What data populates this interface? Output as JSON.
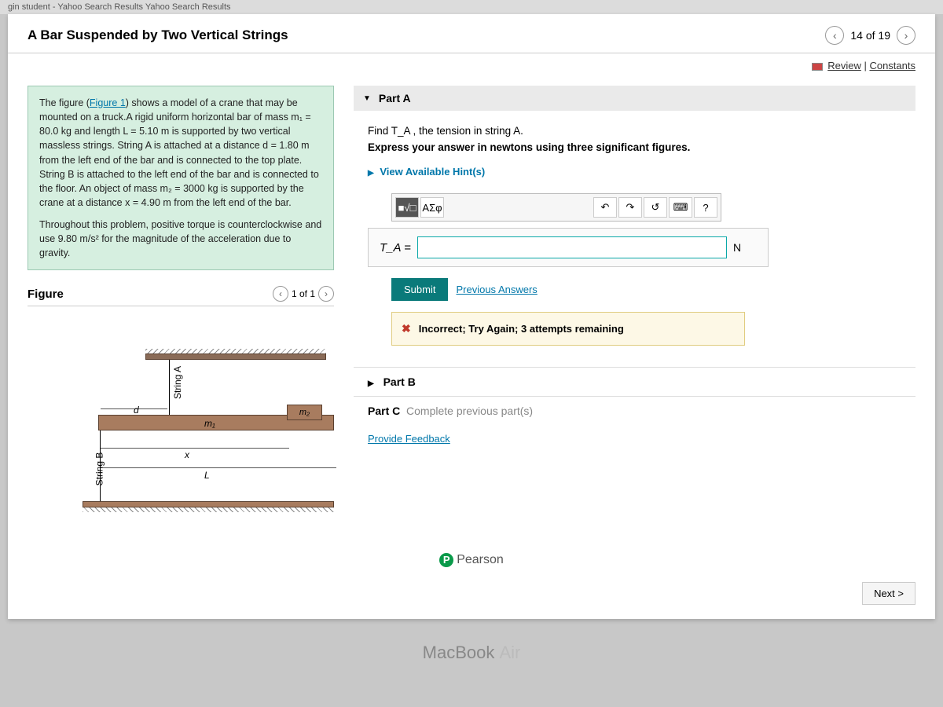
{
  "browser_tab": "gin student - Yahoo Search Results Yahoo Search Results",
  "title": "A Bar Suspended by Two Vertical Strings",
  "nav": {
    "counter": "14 of 19"
  },
  "top_links": {
    "review": "Review",
    "constants": "Constants"
  },
  "intro": {
    "html_parts": {
      "p1a": "The figure (",
      "p1link": "Figure 1",
      "p1b": ") shows a model of a crane that may be mounted on a truck.A rigid uniform horizontal bar of mass m₁ = 80.0 kg and length L = 5.10 m is supported by two vertical massless strings. String A is attached at a distance d = 1.80 m from the left end of the bar and is connected to the top plate. String B is attached to the left end of the bar and is connected to the floor. An object of mass m₂ = 3000 kg is supported by the crane at a distance x = 4.90 m from the left end of the bar.",
      "p2": "Throughout this problem, positive torque is counterclockwise and use 9.80 m/s² for the magnitude of the acceleration due to gravity."
    }
  },
  "figure": {
    "label": "Figure",
    "counter": "1 of 1",
    "labels": {
      "stringA": "String A",
      "stringB": "String B",
      "m1": "m₁",
      "m2": "m₂",
      "d": "d",
      "x": "x",
      "L": "L"
    }
  },
  "partA": {
    "header": "Part A",
    "prompt1": "Find T_A , the tension in string A.",
    "prompt2": "Express your answer in newtons using three significant figures.",
    "hints": "View Available Hint(s)",
    "toolbar": {
      "template": "■√□",
      "greek": "ΑΣφ",
      "undo": "↶",
      "redo": "↷",
      "reset": "↺",
      "keyboard": "⌨",
      "help": "?"
    },
    "var": "T_A =",
    "unit": "N",
    "submit": "Submit",
    "previous": "Previous Answers",
    "feedback": "Incorrect; Try Again; 3 attempts remaining"
  },
  "partB": {
    "header": "Part B"
  },
  "partC": {
    "header": "Part C",
    "note": "Complete previous part(s)"
  },
  "provide_feedback": "Provide Feedback",
  "next": "Next >",
  "pearson": "Pearson",
  "macbook": {
    "a": "MacBook ",
    "b": "Air"
  }
}
